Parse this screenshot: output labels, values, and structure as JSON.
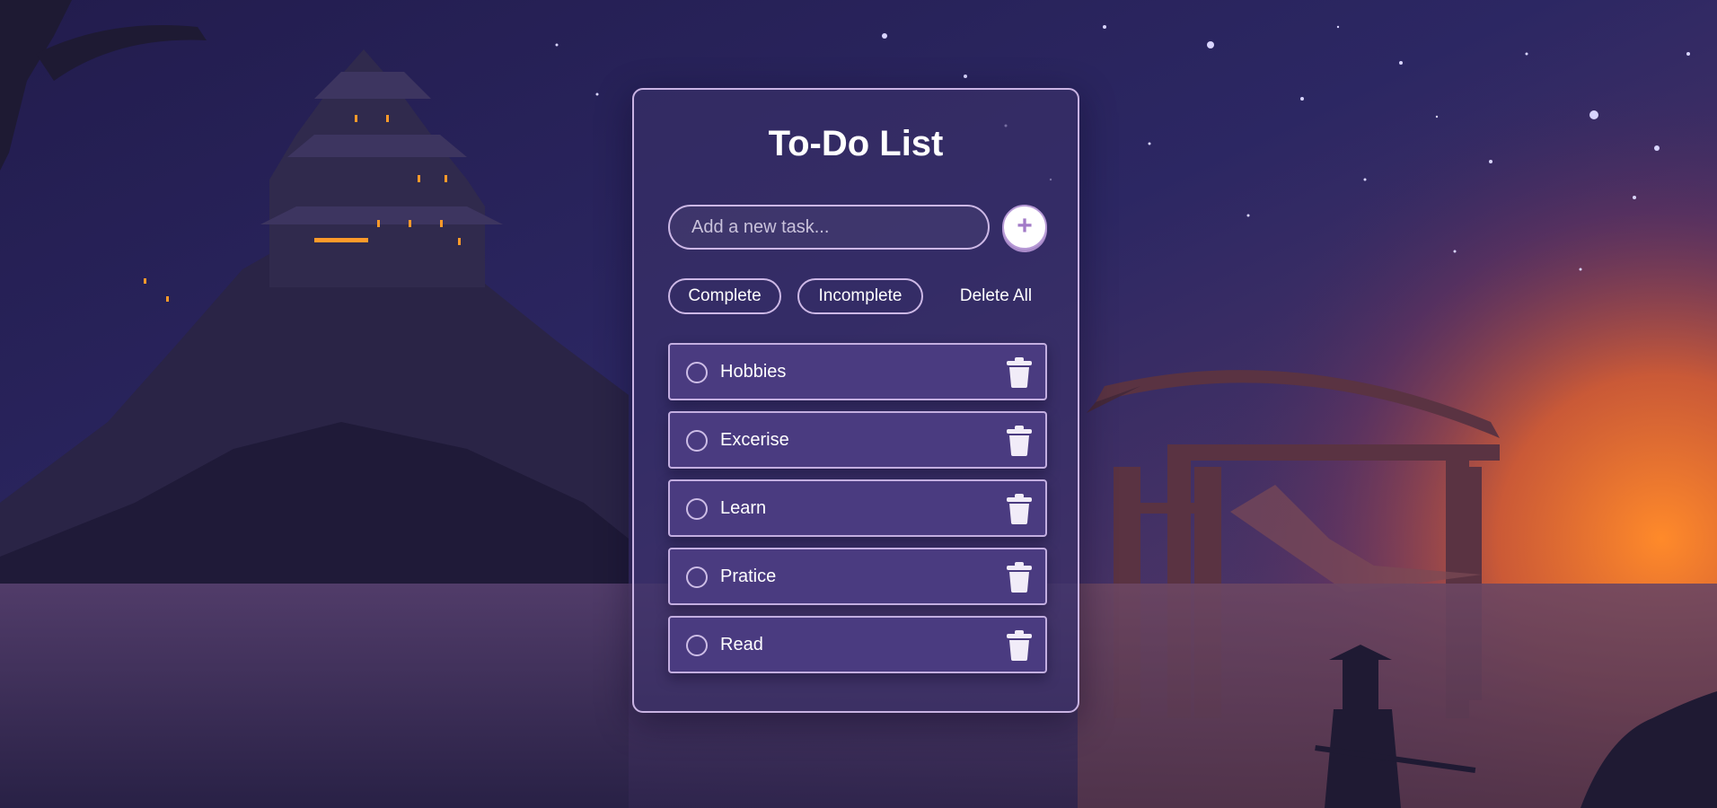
{
  "app": {
    "title": "To-Do List"
  },
  "new_task": {
    "placeholder": "Add a new task...",
    "value": "",
    "add_icon": "plus-icon",
    "add_symbol": "+"
  },
  "filters": {
    "complete_label": "Complete",
    "incomplete_label": "Incomplete",
    "delete_all_label": "Delete All"
  },
  "tasks": [
    {
      "label": "Hobbies",
      "completed": false
    },
    {
      "label": "Excerise",
      "completed": false
    },
    {
      "label": "Learn",
      "completed": false
    },
    {
      "label": "Pratice",
      "completed": false
    },
    {
      "label": "Read",
      "completed": false
    }
  ],
  "icons": {
    "task_status": "circle-checkbox-icon",
    "task_delete": "trash-icon"
  },
  "colors": {
    "accent": "#a27bc7",
    "card_border": "#c9b3e3",
    "task_background": "#4a3b80",
    "text": "#ffffff"
  }
}
